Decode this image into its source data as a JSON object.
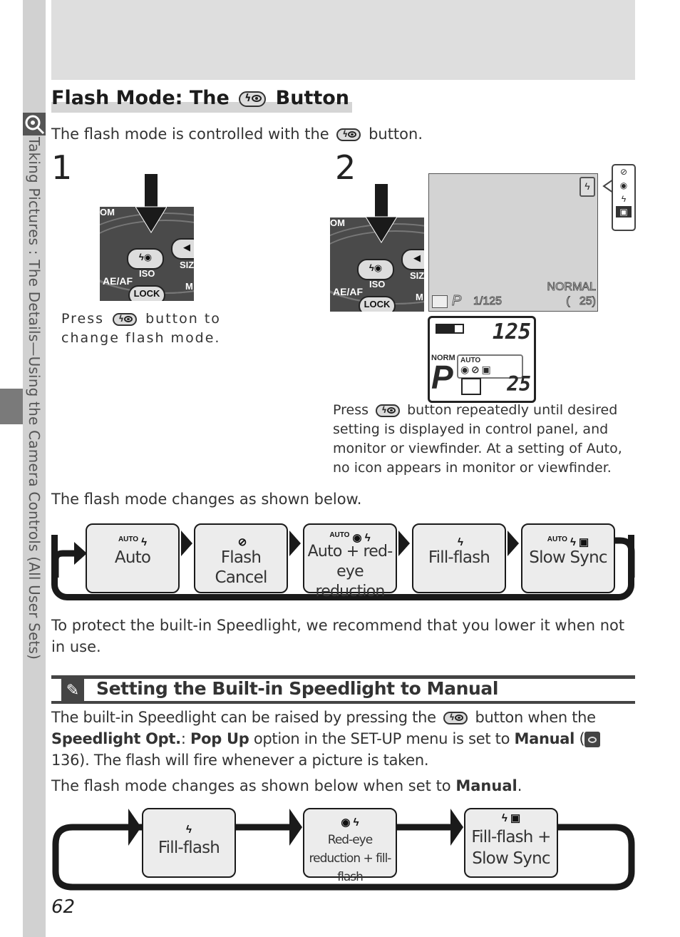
{
  "sidebar": {
    "section_label": "Taking Pictures : The Details—Using the Camera Controls (All User Sets)",
    "icon": "magnifier-camera-icon"
  },
  "header": {
    "title_prefix": "Flash Mode: The",
    "title_suffix": "Button",
    "title_icon": "flash-mode-button-icon"
  },
  "intro": {
    "text_before": "The flash mode is controlled with the",
    "text_after": "button."
  },
  "step1": {
    "number": "1",
    "camera_labels": {
      "zoom_partial": "OM",
      "iso": "ISO",
      "aeaf": "AE/AF",
      "lock": "LOCK",
      "size": "SIZ",
      "m": "M"
    },
    "caption_before": "Press",
    "caption_after": "button to change flash mode."
  },
  "step2": {
    "number": "2",
    "monitor": {
      "shutter": "1/125",
      "mode": "P",
      "quality": "NORMAL",
      "frames": "(   25)",
      "flash_icon": "fill-flash-icon",
      "popout_icons": [
        "flash-cancel-icon",
        "red-eye-icon",
        "fill-flash-icon",
        "slow-sync-icon"
      ]
    },
    "control_panel": {
      "shutter": "125",
      "quality": "NORM",
      "mode": "P",
      "frames": "25",
      "flash_icons": [
        "AUTO",
        "red-eye-icon",
        "flash-cancel-icon",
        "slow-sync-icon"
      ]
    },
    "caption_before": "Press",
    "caption_after": "button repeatedly until desired setting is displayed in control panel, and monitor or viewfinder. At a setting of Auto, no icon appears in monitor or viewfinder."
  },
  "cycle1": {
    "intro": "The flash mode changes as shown below.",
    "modes": [
      {
        "label": "Auto",
        "auto": "AUTO",
        "icons": "ϟ"
      },
      {
        "label": "Flash Cancel",
        "auto": "",
        "icons": "⊘"
      },
      {
        "label": "Auto + red-eye reduction",
        "auto": "AUTO",
        "icons": "◉ ϟ"
      },
      {
        "label": "Fill-flash",
        "auto": "",
        "icons": "ϟ"
      },
      {
        "label": "Slow Sync",
        "auto": "AUTO",
        "icons": "ϟ ▣"
      }
    ]
  },
  "protect_text": "To protect the built-in Speedlight, we recommend that you lower it when not in use.",
  "note": {
    "icon": "pencil-note-icon",
    "title": "Setting the Built-in Speedlight to Manual",
    "line1_before": "The built-in Speedlight can be raised by pressing the",
    "line1_after": "button when the",
    "bold1": "Speedlight Opt.",
    "sep": ":",
    "bold2": "Pop Up",
    "mid": "option in the SET-UP menu is set to",
    "bold3": "Manual",
    "ref_open": "(",
    "ref_page": "136).",
    "line3": "The flash will fire whenever a picture is taken.",
    "manual_before": "The flash mode changes as shown below when set to",
    "manual_bold": "Manual",
    "manual_after": "."
  },
  "cycle2": {
    "modes": [
      {
        "label": "Fill-flash",
        "icons": "ϟ"
      },
      {
        "label": "Red-eye reduction + fill-flash",
        "icons": "◉ ϟ"
      },
      {
        "label": "Fill-flash + Slow Sync",
        "icons": "ϟ ▣"
      }
    ]
  },
  "page_number": "62"
}
